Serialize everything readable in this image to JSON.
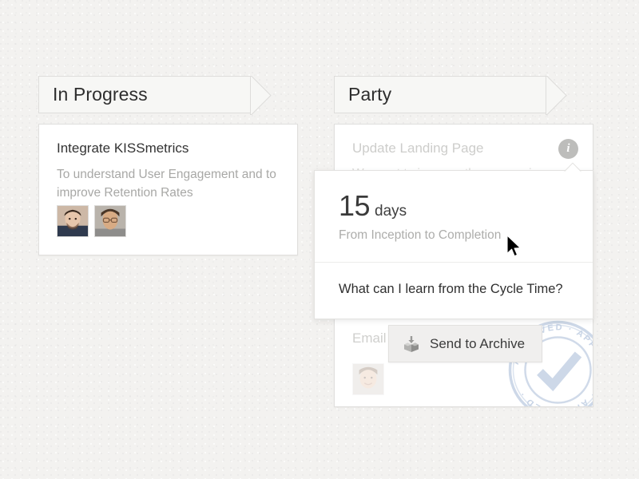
{
  "board": {
    "columns": [
      {
        "id": "in-progress",
        "label": "In Progress"
      },
      {
        "id": "party",
        "label": "Party"
      }
    ]
  },
  "cards": {
    "kissmetrics": {
      "title": "Integrate KISSmetrics",
      "description": "To understand User Engagement and to improve Retention Rates",
      "avatars": [
        {
          "name": "avatar-member-1"
        },
        {
          "name": "avatar-member-2"
        }
      ]
    },
    "update_landing": {
      "title": "Update Landing Page",
      "description": "We want to improve the conversion",
      "info_icon": "i"
    },
    "email": {
      "title": "Email S",
      "avatars": [
        {
          "name": "avatar-member-3"
        }
      ],
      "stamp": {
        "text": "APPROVED · APPROVED · APPROVED ·",
        "color": "#8fa8cc",
        "mark": "check"
      }
    }
  },
  "popover": {
    "metric_value": "15",
    "metric_unit": "days",
    "metric_caption": "From Inception to Completion",
    "question": "What can I learn from the Cycle Time?"
  },
  "tooltip": {
    "label": "Send to Archive",
    "icon": "archive-box-icon"
  },
  "colors": {
    "background": "#f3f2f0",
    "card_background": "#ffffff",
    "card_border": "#e0dfdd",
    "header_background": "#f7f7f5",
    "header_border": "#dedddb",
    "title_text": "#333333",
    "muted_text": "#a8a8a6",
    "dimmed_text": "#cdcdcb",
    "info_icon_background": "#bdbdbb",
    "tooltip_background": "#f0efee",
    "stamp_blue": "#8fa8cc"
  }
}
